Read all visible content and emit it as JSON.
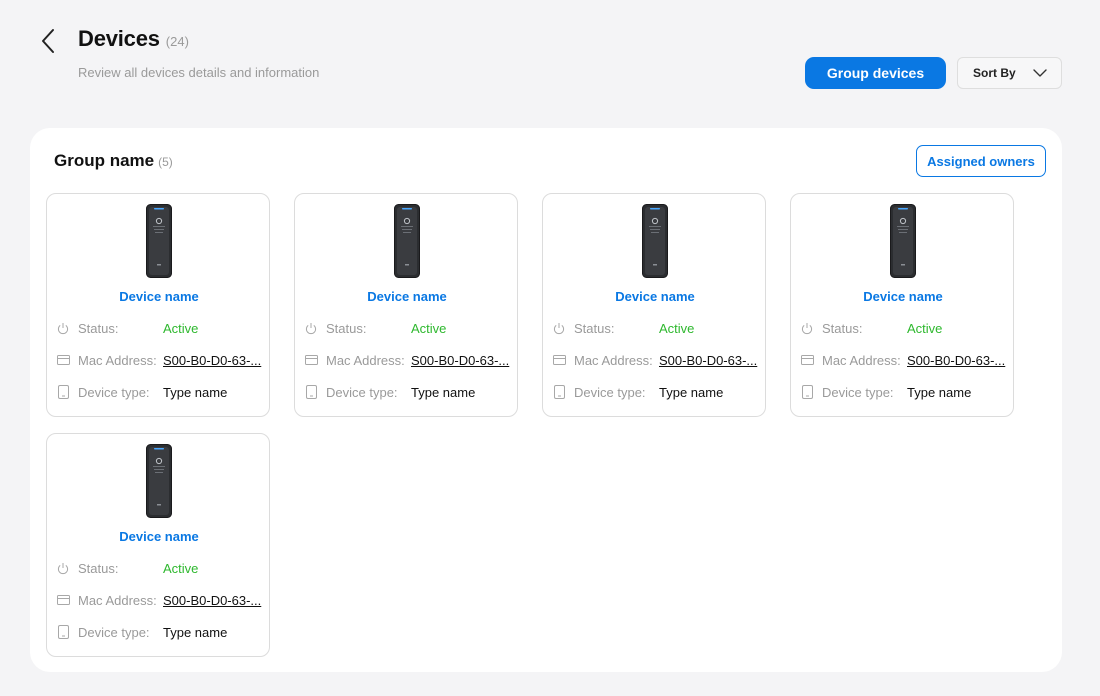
{
  "header": {
    "title": "Devices",
    "count": "(24)",
    "subtitle": "Review all devices details and information",
    "group_devices_label": "Group devices",
    "sort_label": "Sort By"
  },
  "group": {
    "title": "Group name",
    "count": "(5)",
    "assigned_owners_label": "Assigned owners"
  },
  "labels": {
    "status": "Status:",
    "mac": "Mac Address:",
    "type": "Device type:"
  },
  "devices": [
    {
      "name": "Device name",
      "status": "Active",
      "mac": "S00-B0-D0-63-...",
      "type": "Type name"
    },
    {
      "name": "Device name",
      "status": "Active",
      "mac": "S00-B0-D0-63-...",
      "type": "Type name"
    },
    {
      "name": "Device name",
      "status": "Active",
      "mac": "S00-B0-D0-63-...",
      "type": "Type name"
    },
    {
      "name": "Device name",
      "status": "Active",
      "mac": "S00-B0-D0-63-...",
      "type": "Type name"
    },
    {
      "name": "Device name",
      "status": "Active",
      "mac": "S00-B0-D0-63-...",
      "type": "Type name"
    }
  ],
  "colors": {
    "accent": "#0a78e3",
    "status_active": "#2eb82e",
    "background": "#f4f4f6"
  },
  "icons": [
    "chevron-left-icon",
    "chevron-down-icon",
    "power-icon",
    "card-icon",
    "device-icon"
  ]
}
